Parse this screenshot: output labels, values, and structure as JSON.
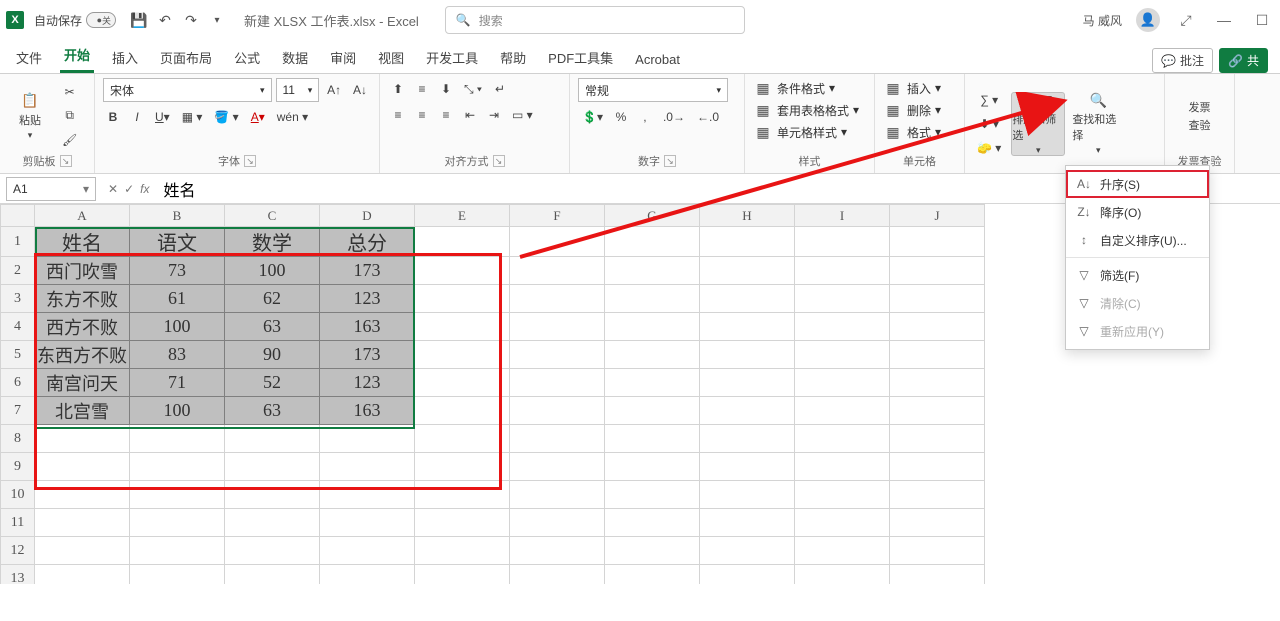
{
  "titlebar": {
    "autosave_label": "自动保存",
    "autosave_state": "关",
    "doc_title": "新建 XLSX 工作表.xlsx  -  Excel",
    "search_placeholder": "搜索",
    "user_name": "马 威风"
  },
  "tabs": {
    "items": [
      "文件",
      "开始",
      "插入",
      "页面布局",
      "公式",
      "数据",
      "审阅",
      "视图",
      "开发工具",
      "帮助",
      "PDF工具集",
      "Acrobat"
    ],
    "active_index": 1,
    "comments_btn": "批注",
    "share_btn": "共"
  },
  "ribbon": {
    "clipboard_label": "剪贴板",
    "paste_label": "粘贴",
    "font": {
      "name": "宋体",
      "size": "11",
      "group_label": "字体"
    },
    "align_label": "对齐方式",
    "number": {
      "format": "常规",
      "group_label": "数字"
    },
    "styles": {
      "cond_format": "条件格式",
      "table_format": "套用表格格式",
      "cell_style": "单元格样式",
      "group_label": "样式"
    },
    "cells": {
      "insert": "插入",
      "delete": "删除",
      "format": "格式",
      "group_label": "单元格"
    },
    "editing": {
      "sort_filter": "排序和筛选",
      "find_select": "查找和选择"
    },
    "invoice": {
      "label1": "发票",
      "label2": "查验",
      "group_label": "发票查验"
    }
  },
  "dropdown": {
    "asc": "升序(S)",
    "desc": "降序(O)",
    "custom": "自定义排序(U)...",
    "filter": "筛选(F)",
    "clear": "清除(C)",
    "reapply": "重新应用(Y)"
  },
  "formula_bar": {
    "namebox": "A1",
    "formula": "姓名"
  },
  "grid": {
    "col_headers": [
      "A",
      "B",
      "C",
      "D",
      "E",
      "F",
      "G",
      "H",
      "I",
      "J"
    ],
    "row_headers": [
      "1",
      "2",
      "3",
      "4",
      "5",
      "6",
      "7",
      "8",
      "9",
      "10",
      "11",
      "12",
      "13"
    ],
    "data": {
      "header_row": [
        "姓名",
        "语文",
        "数学",
        "总分"
      ],
      "rows": [
        [
          "西门吹雪",
          "73",
          "100",
          "173"
        ],
        [
          "东方不败",
          "61",
          "62",
          "123"
        ],
        [
          "西方不败",
          "100",
          "63",
          "163"
        ],
        [
          "东西方不败",
          "83",
          "90",
          "173"
        ],
        [
          "南宫问天",
          "71",
          "52",
          "123"
        ],
        [
          "北宫雪",
          "100",
          "63",
          "163"
        ]
      ]
    }
  },
  "chart_data": {
    "type": "table",
    "title": "",
    "columns": [
      "姓名",
      "语文",
      "数学",
      "总分"
    ],
    "rows": [
      {
        "姓名": "西门吹雪",
        "语文": 73,
        "数学": 100,
        "总分": 173
      },
      {
        "姓名": "东方不败",
        "语文": 61,
        "数学": 62,
        "总分": 123
      },
      {
        "姓名": "西方不败",
        "语文": 100,
        "数学": 63,
        "总分": 163
      },
      {
        "姓名": "东西方不败",
        "语文": 83,
        "数学": 90,
        "总分": 173
      },
      {
        "姓名": "南宫问天",
        "语文": 71,
        "数学": 52,
        "总分": 123
      },
      {
        "姓名": "北宫雪",
        "语文": 100,
        "数学": 63,
        "总分": 163
      }
    ]
  }
}
